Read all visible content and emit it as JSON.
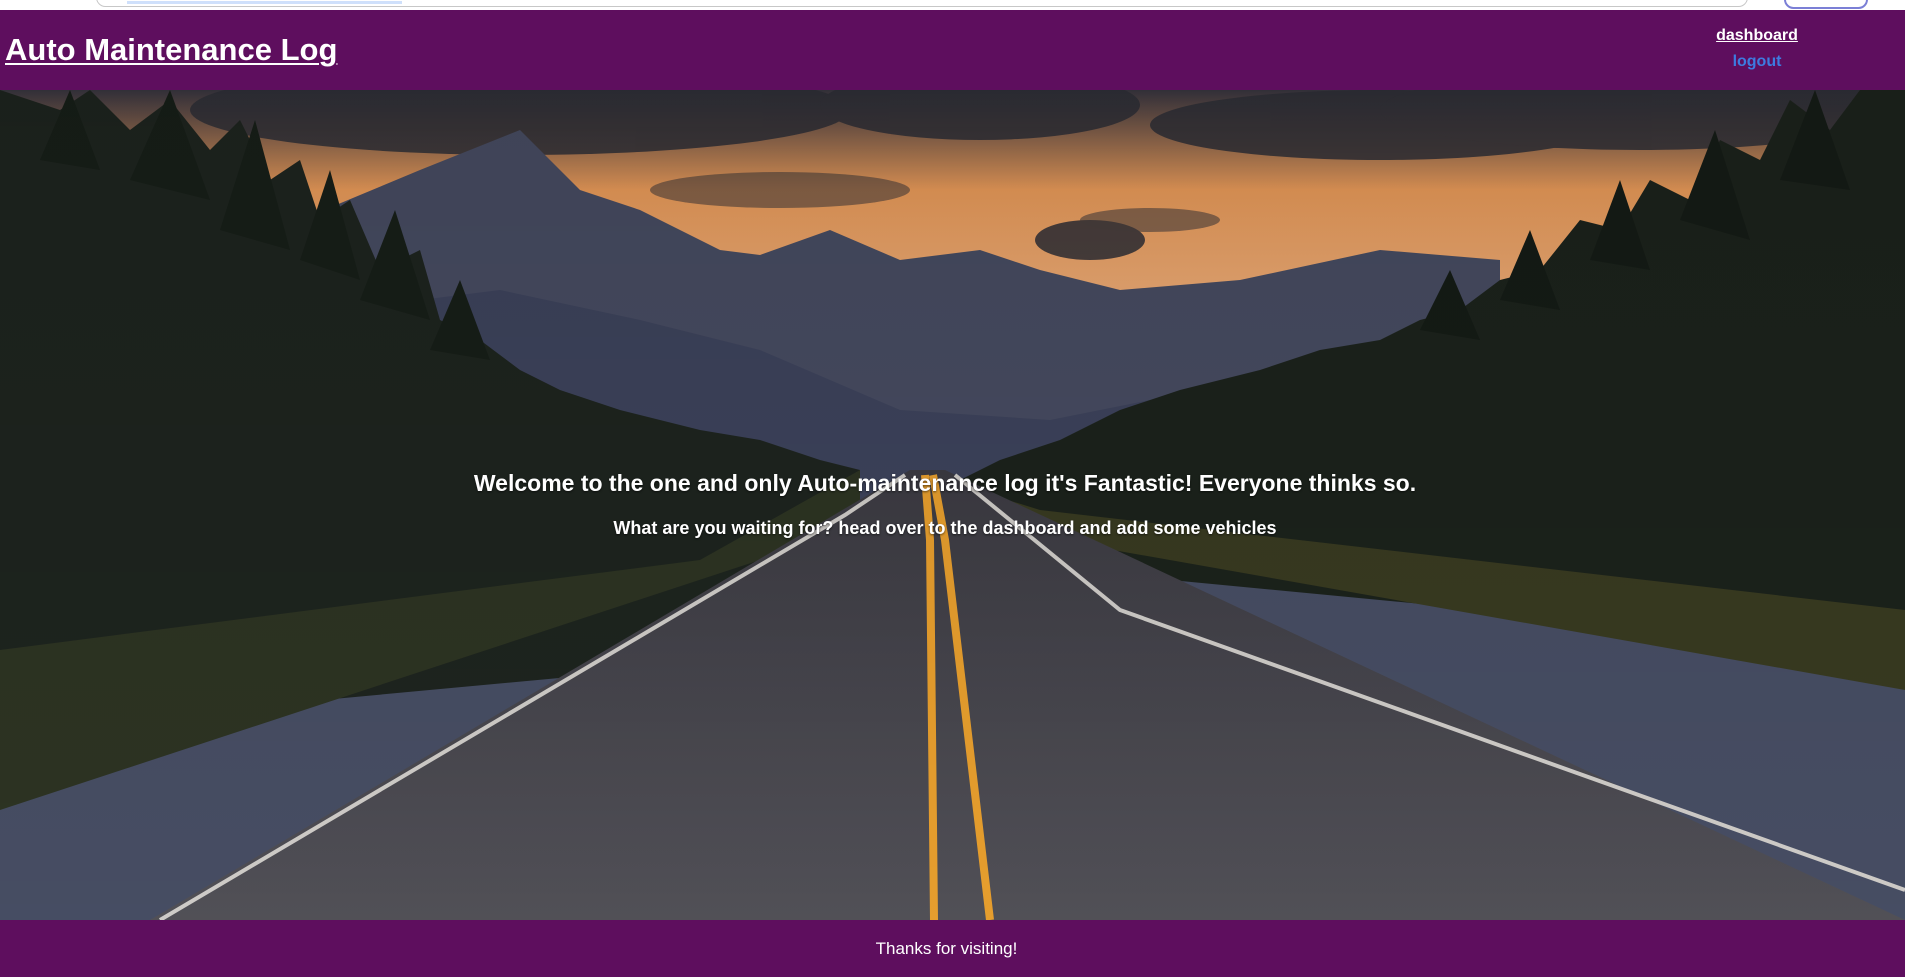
{
  "header": {
    "title": "Auto Maintenance Log",
    "nav": {
      "dashboard": "dashboard",
      "logout": "logout"
    }
  },
  "hero": {
    "heading": "Welcome to the one and only Auto-maintenance log it's Fantastic! Everyone thinks so.",
    "subheading": "What are you waiting for? head over to the dashboard and add some vehicles"
  },
  "footer": {
    "text": "Thanks for visiting!"
  },
  "colors": {
    "brand": "#5e0e5e",
    "link": "#3d7be0",
    "text_on_brand": "#ffffff"
  }
}
